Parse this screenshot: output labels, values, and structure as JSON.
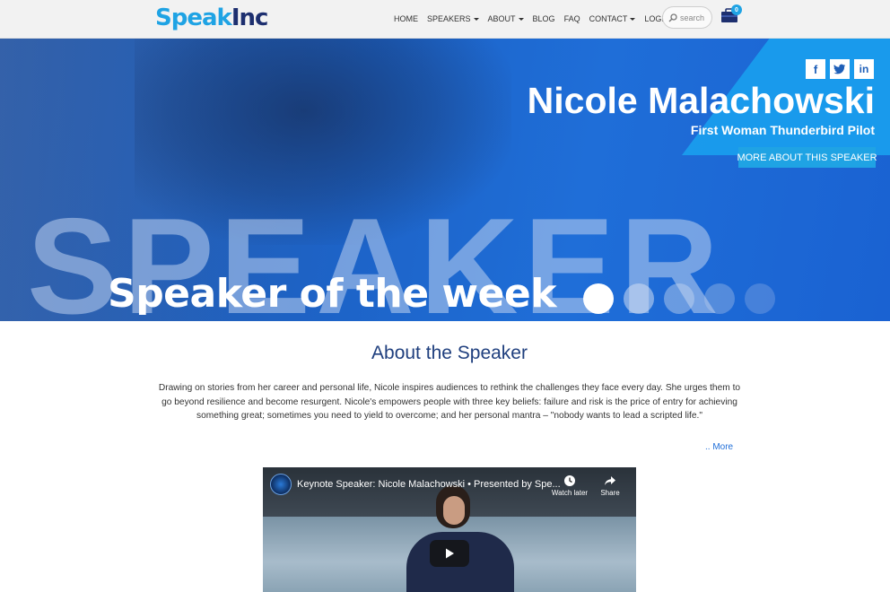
{
  "header": {
    "logo": {
      "part1": "Speak",
      "part2": "Inc"
    },
    "nav": [
      {
        "label": "HOME",
        "dropdown": false
      },
      {
        "label": "SPEAKERS",
        "dropdown": true
      },
      {
        "label": "ABOUT",
        "dropdown": true
      },
      {
        "label": "BLOG",
        "dropdown": false
      },
      {
        "label": "FAQ",
        "dropdown": false
      },
      {
        "label": "CONTACT",
        "dropdown": true
      },
      {
        "label": "LOGIN",
        "dropdown": true
      }
    ],
    "search_placeholder": "search",
    "cart_count": "0"
  },
  "hero": {
    "background_word": "SPEAKER",
    "tagline": "Speaker of the week",
    "speaker_name": "Nicole Malachowski",
    "speaker_title": "First Woman Thunderbird Pilot",
    "more_button": "MORE ABOUT THIS SPEAKER",
    "social": [
      "facebook-icon",
      "twitter-icon",
      "linkedin-icon"
    ],
    "carousel": {
      "count": 5,
      "active_index": 0
    }
  },
  "about": {
    "heading": "About the Speaker",
    "body": "Drawing on stories from her career and personal life, Nicole inspires audiences to rethink the challenges they face every day. She urges them to go beyond resilience and become resurgent. Nicole's empowers people with three key beliefs: failure and risk is the price of entry for achieving something great; sometimes you need to yield to overcome; and her personal mantra – \"nobody wants to lead a scripted life.\"",
    "more_link": ".. More"
  },
  "video": {
    "title": "Keynote Speaker: Nicole Malachowski • Presented by Spe...",
    "watch_later": "Watch later",
    "share": "Share"
  },
  "colors": {
    "brand_blue": "#1fa3e4",
    "brand_navy": "#1d2f6f",
    "hero_blue": "#1d63c7"
  }
}
